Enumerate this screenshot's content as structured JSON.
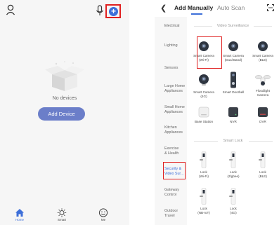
{
  "home": {
    "empty_text": "No devices",
    "add_button": "Add Device",
    "nav": [
      {
        "label": "Home",
        "icon": "house-icon"
      },
      {
        "label": "Smart",
        "icon": "sun-icon"
      },
      {
        "label": "Me",
        "icon": "smiley-icon"
      }
    ],
    "accent_color": "#3d6fd9",
    "button_color": "#6b7ec9",
    "highlight_color": "#e02020"
  },
  "add": {
    "tabs": [
      "Add Manually",
      "Auto Scan"
    ],
    "categories": [
      "Electrical",
      "Lighting",
      "Sensors",
      "Large Home\nAppliances",
      "Small Home\nAppliances",
      "Kitchen\nAppliances",
      "Exercise\n& Health",
      "Security &\nVideo Sur...",
      "Gateway\nControl",
      "Outdoor\nTravel"
    ],
    "sections": [
      {
        "title": "Video Surveillance"
      },
      {
        "title": "Smart Lock"
      }
    ],
    "devices": [
      {
        "label": "Smart Camera\n(Wi-Fi)",
        "icon": "camera-icon"
      },
      {
        "label": "Smart Camera\n(Dual Band)",
        "icon": "camera-icon"
      },
      {
        "label": "Smart Camera\n(BLE)",
        "icon": "camera-icon"
      },
      {
        "label": "Smart Camera\n(4G)",
        "icon": "camera-icon"
      },
      {
        "label": "Smart Doorbell",
        "icon": "doorbell-icon"
      },
      {
        "label": "Floodlight\nCamera",
        "icon": "floodlight-icon"
      },
      {
        "label": "Base Station",
        "icon": "base-station-icon"
      },
      {
        "label": "NVR",
        "icon": "nvr-icon"
      },
      {
        "label": "DVR",
        "icon": "dvr-icon"
      },
      {
        "label": "Lock\n(Wi-Fi)",
        "icon": "lock-icon"
      },
      {
        "label": "Lock\n(Zigbee)",
        "icon": "lock-icon"
      },
      {
        "label": "Lock\n(BLE)",
        "icon": "lock-icon"
      },
      {
        "label": "Lock\n(NB-IoT)",
        "icon": "lock-icon"
      },
      {
        "label": "Lock\n(4G)",
        "icon": "lock-icon"
      }
    ]
  }
}
